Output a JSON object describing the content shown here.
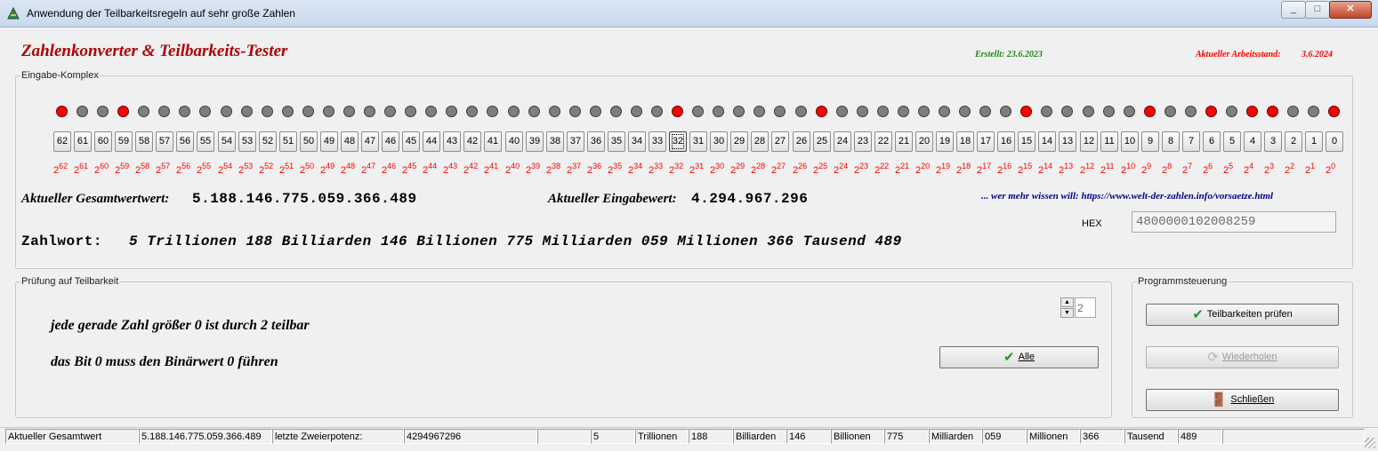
{
  "window": {
    "title": "Anwendung der Teilbarkeitsregeln auf sehr große Zahlen",
    "controls": [
      "_",
      "□",
      "✕"
    ]
  },
  "header": {
    "app_title": "Zahlenkonverter & Teilbarkeits-Tester",
    "created": "Erstellt: 23.6.2023",
    "status_label": "Aktueller Arbeitsstand:",
    "status_date": "3.6.2024"
  },
  "input_group": {
    "legend": "Eingabe-Komplex",
    "bits_active": [
      62,
      59,
      32,
      25,
      15,
      9,
      6,
      4,
      3,
      0
    ],
    "selected_bit": 32,
    "power_base": "2",
    "total_label": "Aktueller Gesamtwertwert:",
    "total_value": "5.188.146.775.059.366.489",
    "input_label": "Aktueller Eingabewert:",
    "input_value": "4.294.967.296",
    "link_text": "... wer mehr wissen will: https://www.welt-der-zahlen.info/vorsaetze.html",
    "hex_label": "HEX",
    "hex_value": "4800000102008259",
    "zahlwort_label": "Zahlwort:",
    "zahlwort_value": "5 Trillionen 188 Billiarden 146 Billionen 775 Milliarden 059 Millionen 366 Tausend 489"
  },
  "check_group": {
    "legend": "Prüfung auf Teilbarkeit",
    "rule_line1": "jede gerade Zahl größer 0 ist durch 2 teilbar",
    "rule_line2": "das Bit 0 muss den Binärwert 0 führen",
    "divisor_value": "2",
    "all_button": "Alle"
  },
  "control_group": {
    "legend": "Programmsteuerung",
    "check_button": "Teilbarkeiten prüfen",
    "repeat_button": "Wiederholen",
    "close_button": "Schließen"
  },
  "statusbar": [
    {
      "text": "Aktueller Gesamtwert"
    },
    {
      "text": "5.188.146.775.059.366.489"
    },
    {
      "text": "letzte Zweierpotenz:"
    },
    {
      "text": "4294967296"
    },
    {
      "text": ""
    },
    {
      "text": "5"
    },
    {
      "text": "Trillionen"
    },
    {
      "text": "188"
    },
    {
      "text": "Billiarden"
    },
    {
      "text": "146"
    },
    {
      "text": "Billionen"
    },
    {
      "text": "775"
    },
    {
      "text": "Milliarden"
    },
    {
      "text": "059"
    },
    {
      "text": "Millionen"
    },
    {
      "text": "366"
    },
    {
      "text": "Tausend"
    },
    {
      "text": "489"
    },
    {
      "text": ""
    }
  ],
  "colors": {
    "title_red": "#b00000",
    "created_green": "#1a8a1a",
    "status_red": "#ff0000",
    "link_blue": "#00008b",
    "bit_on": "#ff0000",
    "bit_off": "#7e7e7e"
  },
  "icons": {
    "check_button": "check-icon",
    "repeat_button": "refresh-icon",
    "close_button": "exit-door-icon"
  }
}
